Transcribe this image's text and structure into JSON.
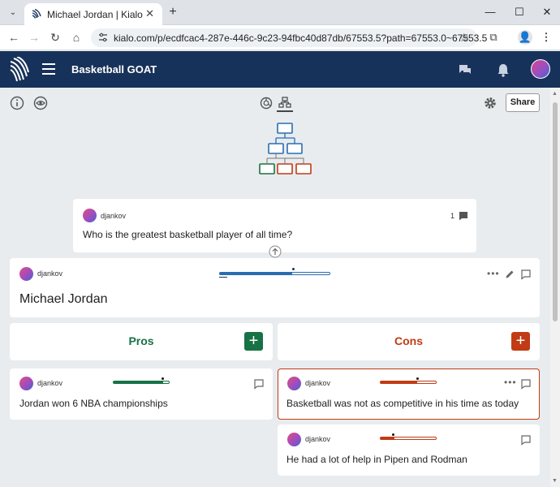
{
  "browser": {
    "tab_title": "Michael Jordan | Kialo",
    "url": "kialo.com/p/ecdfcac4-287e-446c-9c23-94fbc40d87db/67553.5?path=67553.0~67553.5",
    "icons": [
      "chevron-down-icon",
      "close-icon",
      "plus-icon",
      "minimize-icon",
      "maximize-icon",
      "back-icon",
      "forward-icon",
      "reload-icon",
      "home-icon",
      "site-info-icon",
      "star-icon",
      "extensions-icon",
      "profile-icon",
      "more-icon"
    ]
  },
  "app": {
    "title": "Basketball GOAT",
    "colors": {
      "header": "#17325a",
      "pro": "#177245",
      "con": "#c13b14",
      "neutral": "#2a6db0"
    }
  },
  "toolbar": {
    "share_label": "Share"
  },
  "parent": {
    "author": "djankov",
    "comment_count": "1",
    "text": "Who is the greatest basketball player of all time?"
  },
  "main_claim": {
    "author": "djankov",
    "text": "Michael Jordan",
    "vote_level": 0.66
  },
  "columns": {
    "pros_label": "Pros",
    "cons_label": "Cons"
  },
  "pros": [
    {
      "author": "djankov",
      "text": "Jordan won 6 NBA championships",
      "vote_level": 0.9
    }
  ],
  "cons": [
    {
      "author": "djankov",
      "text": "Basketball was not as competitive in his time as today",
      "vote_level": 0.66
    },
    {
      "author": "djankov",
      "text": "He had a lot of help in Pipen and Rodman",
      "vote_level": 0.25
    }
  ]
}
